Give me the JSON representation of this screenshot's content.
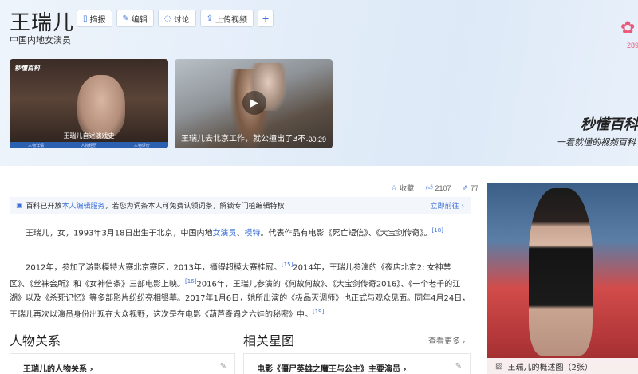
{
  "header": {
    "title": "王瑞儿",
    "subtitle": "中国内地女演员",
    "actions": [
      {
        "icon": "bookmark-icon",
        "glyph": "▯",
        "label": "摘报"
      },
      {
        "icon": "edit-icon",
        "glyph": "✎",
        "label": "编辑"
      },
      {
        "icon": "chat-icon",
        "glyph": "◌",
        "label": "讨论"
      },
      {
        "icon": "upload-video-icon",
        "glyph": "⇪",
        "label": "上传视频"
      }
    ],
    "add_glyph": "+",
    "flower_glyph": "✿",
    "flower_count": "289"
  },
  "videos": [
    {
      "logo": "秒懂百科",
      "caption": "王瑞儿自述演戏史",
      "bar": [
        "人物详情",
        "人物经历",
        "人物评价"
      ]
    },
    {
      "caption": "王瑞儿去北京工作，就公撞出了3不…",
      "duration": "00:29"
    }
  ],
  "promo": {
    "logo": "秒懂百科",
    "slogan": "一看就懂的视频百科"
  },
  "stats": {
    "favorite": "收藏",
    "likes": "2107",
    "shares": "77"
  },
  "notice": {
    "prefix": "百科已开放",
    "link": "本人编辑服务",
    "text": "，若您为词条本人可免费认领词条，解锁专门植编辑特权",
    "go": "立即前往 ›"
  },
  "intro": {
    "p1_a": "王瑞儿，女，1993年3月18日出生于北京，中国内地",
    "p1_link1": "女演员",
    "p1_sep": "、",
    "p1_link2": "模特",
    "p1_b": "。代表作品有电影《死亡短信》、《大宝剑传奇》。",
    "p1_ref": "[18]",
    "p2_a": "2012年，参加了游影模特大赛北京赛区，2013年，摘得超模大赛桂冠。",
    "p2_ref1": "[15]",
    "p2_b": "2014年，王瑞儿参演的《夜店北京2: 女神禁区》、《丝袜会所》和《女神信条》三部电影上映。",
    "p2_ref2": "[16]",
    "p2_c": "2016年，王瑞儿参演的《何故何故》、《大宝剑传奇2016》、《一个老千的江湖》以及《杀死记忆》等多部影片纷纷亮相银幕。2017年1月6日，她所出演的《极品灭调师》也正式与观众见面。同年4月24日，王瑞儿再次以演员身份出现在大众视野，这次是在电影《葫芦奇遇之六娃的秘密》中。",
    "p2_ref3": "[19]"
  },
  "sections": {
    "relations": {
      "title": "人物关系",
      "card": "王瑞儿的人物关系 ›"
    },
    "stars": {
      "title": "相关星图",
      "more": "查看更多 ›",
      "card": "电影《僵尸英雄之魔王与公主》主要演员 ›"
    }
  },
  "photo": {
    "caption": "王瑞儿的概述图（2张）"
  }
}
